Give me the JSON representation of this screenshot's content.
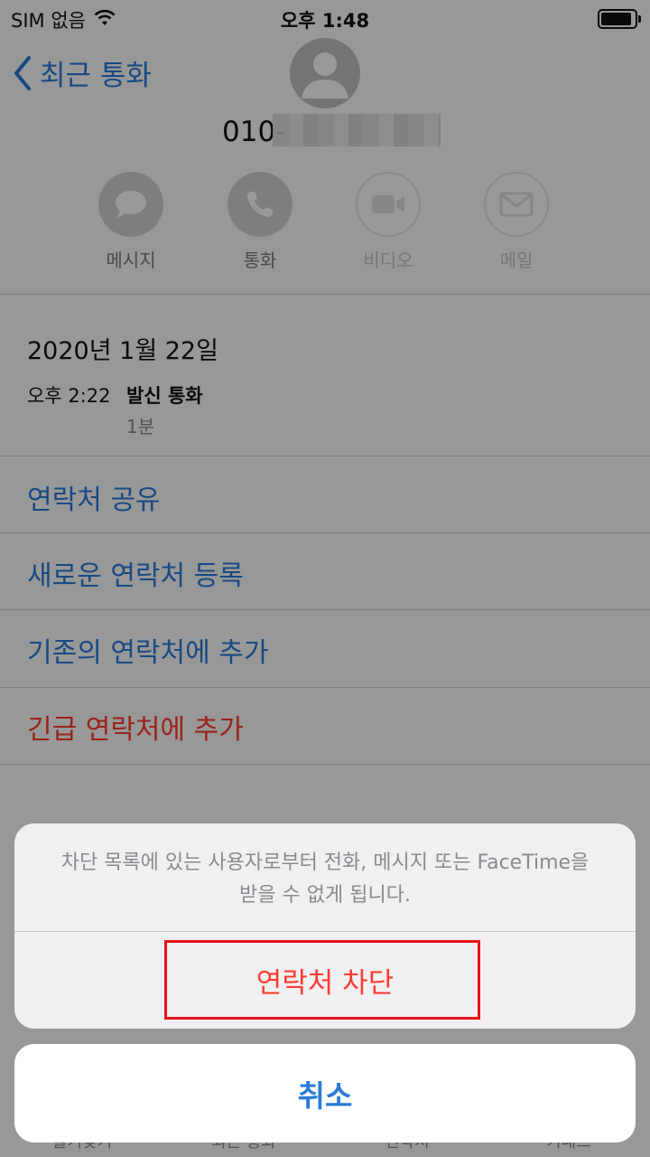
{
  "status_bar": {
    "carrier": "SIM 없음",
    "time": "오후 1:48"
  },
  "nav": {
    "back_label": "최근 통화"
  },
  "contact": {
    "phone_visible": "010-"
  },
  "actions": [
    {
      "label": "메시지",
      "icon": "message-icon",
      "enabled": true
    },
    {
      "label": "통화",
      "icon": "phone-icon",
      "enabled": true
    },
    {
      "label": "비디오",
      "icon": "video-icon",
      "enabled": false
    },
    {
      "label": "메일",
      "icon": "mail-icon",
      "enabled": false
    }
  ],
  "call_log": {
    "date": "2020년 1월 22일",
    "time": "오후 2:22",
    "type": "발신 통화",
    "duration": "1분"
  },
  "menu": [
    {
      "label": "연락처 공유"
    },
    {
      "label": "새로운 연락처 등록"
    },
    {
      "label": "기존의 연락처에 추가"
    },
    {
      "label": "긴급 연락처에 추가"
    }
  ],
  "tabbar": [
    "즐겨찾기",
    "최근 통화",
    "연락처",
    "키패드"
  ],
  "sheet": {
    "message_line1": "차단 목록에 있는 사용자로부터 전화, 메시지 또는 FaceTime을",
    "message_line2": "받을 수 없게 됩니다.",
    "block_label": "연락처 차단",
    "cancel_label": "취소"
  },
  "colors": {
    "accent": "#2a7ad8",
    "destructive": "#ff3b30",
    "highlight_box": "#e8141b"
  }
}
